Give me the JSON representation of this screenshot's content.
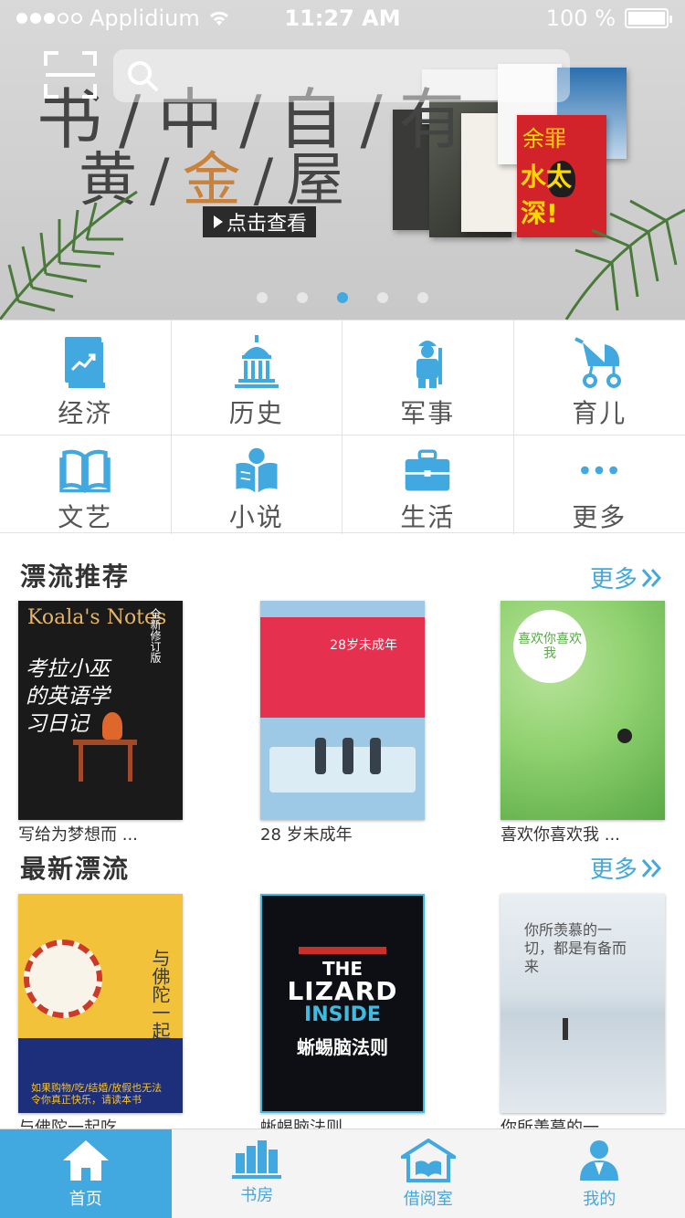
{
  "status_bar": {
    "carrier": "Applidium",
    "time": "11:27 AM",
    "battery": "100 %"
  },
  "banner": {
    "search_placeholder": "",
    "slogan_line1": "书/中/自/有",
    "slogan_line2_a": "黄/",
    "slogan_line2_b": "金",
    "slogan_line2_c": "/屋",
    "view_button": "点击查看",
    "book_caption_top": "余罪",
    "book_caption_bottom": "水太深!",
    "carousel_count": 5,
    "carousel_active_index": 2
  },
  "categories": [
    {
      "label": "经济",
      "icon": "chart-book-icon"
    },
    {
      "label": "历史",
      "icon": "capitol-building-icon"
    },
    {
      "label": "军事",
      "icon": "soldier-icon"
    },
    {
      "label": "育儿",
      "icon": "baby-stroller-icon"
    },
    {
      "label": "文艺",
      "icon": "open-book-icon"
    },
    {
      "label": "小说",
      "icon": "reader-icon"
    },
    {
      "label": "生活",
      "icon": "briefcase-icon"
    },
    {
      "label": "更多",
      "icon": "more-dots-icon"
    }
  ],
  "sections": [
    {
      "title": "漂流推荐",
      "more": "更多",
      "books": [
        {
          "name": "写给为梦想而 ...",
          "cover": {
            "en": "Koala's Notes",
            "cn": "考拉小巫的英语学习日记",
            "badge": "全新修订版"
          }
        },
        {
          "name": "28 岁未成年",
          "cover": {
            "title": "28岁未成年"
          }
        },
        {
          "name": "喜欢你喜欢我 ...",
          "cover": {
            "title": "喜欢你喜欢我"
          }
        }
      ]
    },
    {
      "title": "最新漂流",
      "more": "更多",
      "books": [
        {
          "name": "与佛陀一起吃 ...",
          "cover": {
            "title": "与佛陀一起吃早餐",
            "band": "如果购物/吃/结婚/放假也无法令你真正快乐，请读本书"
          }
        },
        {
          "name": "蜥蜴脑法则",
          "cover": {
            "the": "THE",
            "lizard": "LIZARD",
            "inside": "INSIDE",
            "cn": "蜥蜴脑法则"
          }
        },
        {
          "name": "你所羡慕的一 ...",
          "cover": {
            "title": "你所羡慕的一切，都是有备而来"
          }
        }
      ]
    }
  ],
  "tabbar": [
    {
      "label": "首页",
      "icon": "home-icon",
      "active": true
    },
    {
      "label": "书房",
      "icon": "bookshelf-icon",
      "active": false
    },
    {
      "label": "借阅室",
      "icon": "library-icon",
      "active": false
    },
    {
      "label": "我的",
      "icon": "user-icon",
      "active": false
    }
  ],
  "colors": {
    "accent": "#41a8e0",
    "banner_gold": "#c9823c"
  }
}
